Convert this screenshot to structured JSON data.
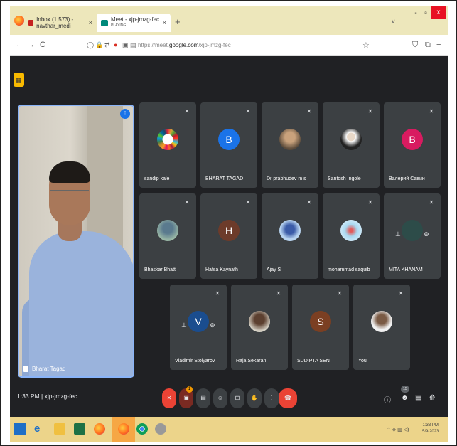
{
  "browser": {
    "tabs": [
      {
        "title": "Inbox (1,573) - navthar_medi",
        "close": "×"
      },
      {
        "title": "Meet - xjp-jmzg-fec",
        "subtitle": "PLAYING",
        "close": "×"
      }
    ],
    "new_tab": "+",
    "url_prefix": "https://meet.",
    "url_domain": "google.com",
    "url_path": "/xjp-jmzg-fec"
  },
  "meet": {
    "main_speaker": "Bharat Tagad",
    "participants": [
      {
        "name": "sandip kale",
        "avatar": "",
        "style": "dots"
      },
      {
        "name": "BHARAT TAGAD",
        "avatar": "B",
        "color": "#1a73e8"
      },
      {
        "name": "Dr prabhudev m s",
        "avatar": "",
        "style": "photo1"
      },
      {
        "name": "Santosh Ingole",
        "avatar": "",
        "style": "photo2"
      },
      {
        "name": "Валерий Савин",
        "avatar": "B",
        "color": "#d81b60"
      },
      {
        "name": "Bhaskar Bhatt",
        "avatar": "",
        "style": "photo3"
      },
      {
        "name": "Hafsa Kaynath",
        "avatar": "H",
        "color": "#6d3b2a"
      },
      {
        "name": "Ajay S",
        "avatar": "",
        "style": "photo4"
      },
      {
        "name": "mohammad saquib",
        "avatar": "",
        "style": "photo5"
      },
      {
        "name": "MITA KHANAM",
        "avatar": "",
        "style": "dim"
      },
      {
        "name": "Vladimir Stolyarov",
        "avatar": "V",
        "color": "#1a4d8f"
      },
      {
        "name": "Raja Sekaran",
        "avatar": "",
        "style": "photo6"
      },
      {
        "name": "SUDIPTA SEN",
        "avatar": "S",
        "color": "#7b3f22"
      },
      {
        "name": "You",
        "avatar": "",
        "style": "photo7"
      }
    ],
    "time": "1:33 PM",
    "separator": "|",
    "meeting_code": "xjp-jmzg-fec",
    "notification_badge": "1",
    "participant_count": "15"
  },
  "taskbar": {
    "time": "1:33 PM",
    "date": "5/9/2023"
  }
}
